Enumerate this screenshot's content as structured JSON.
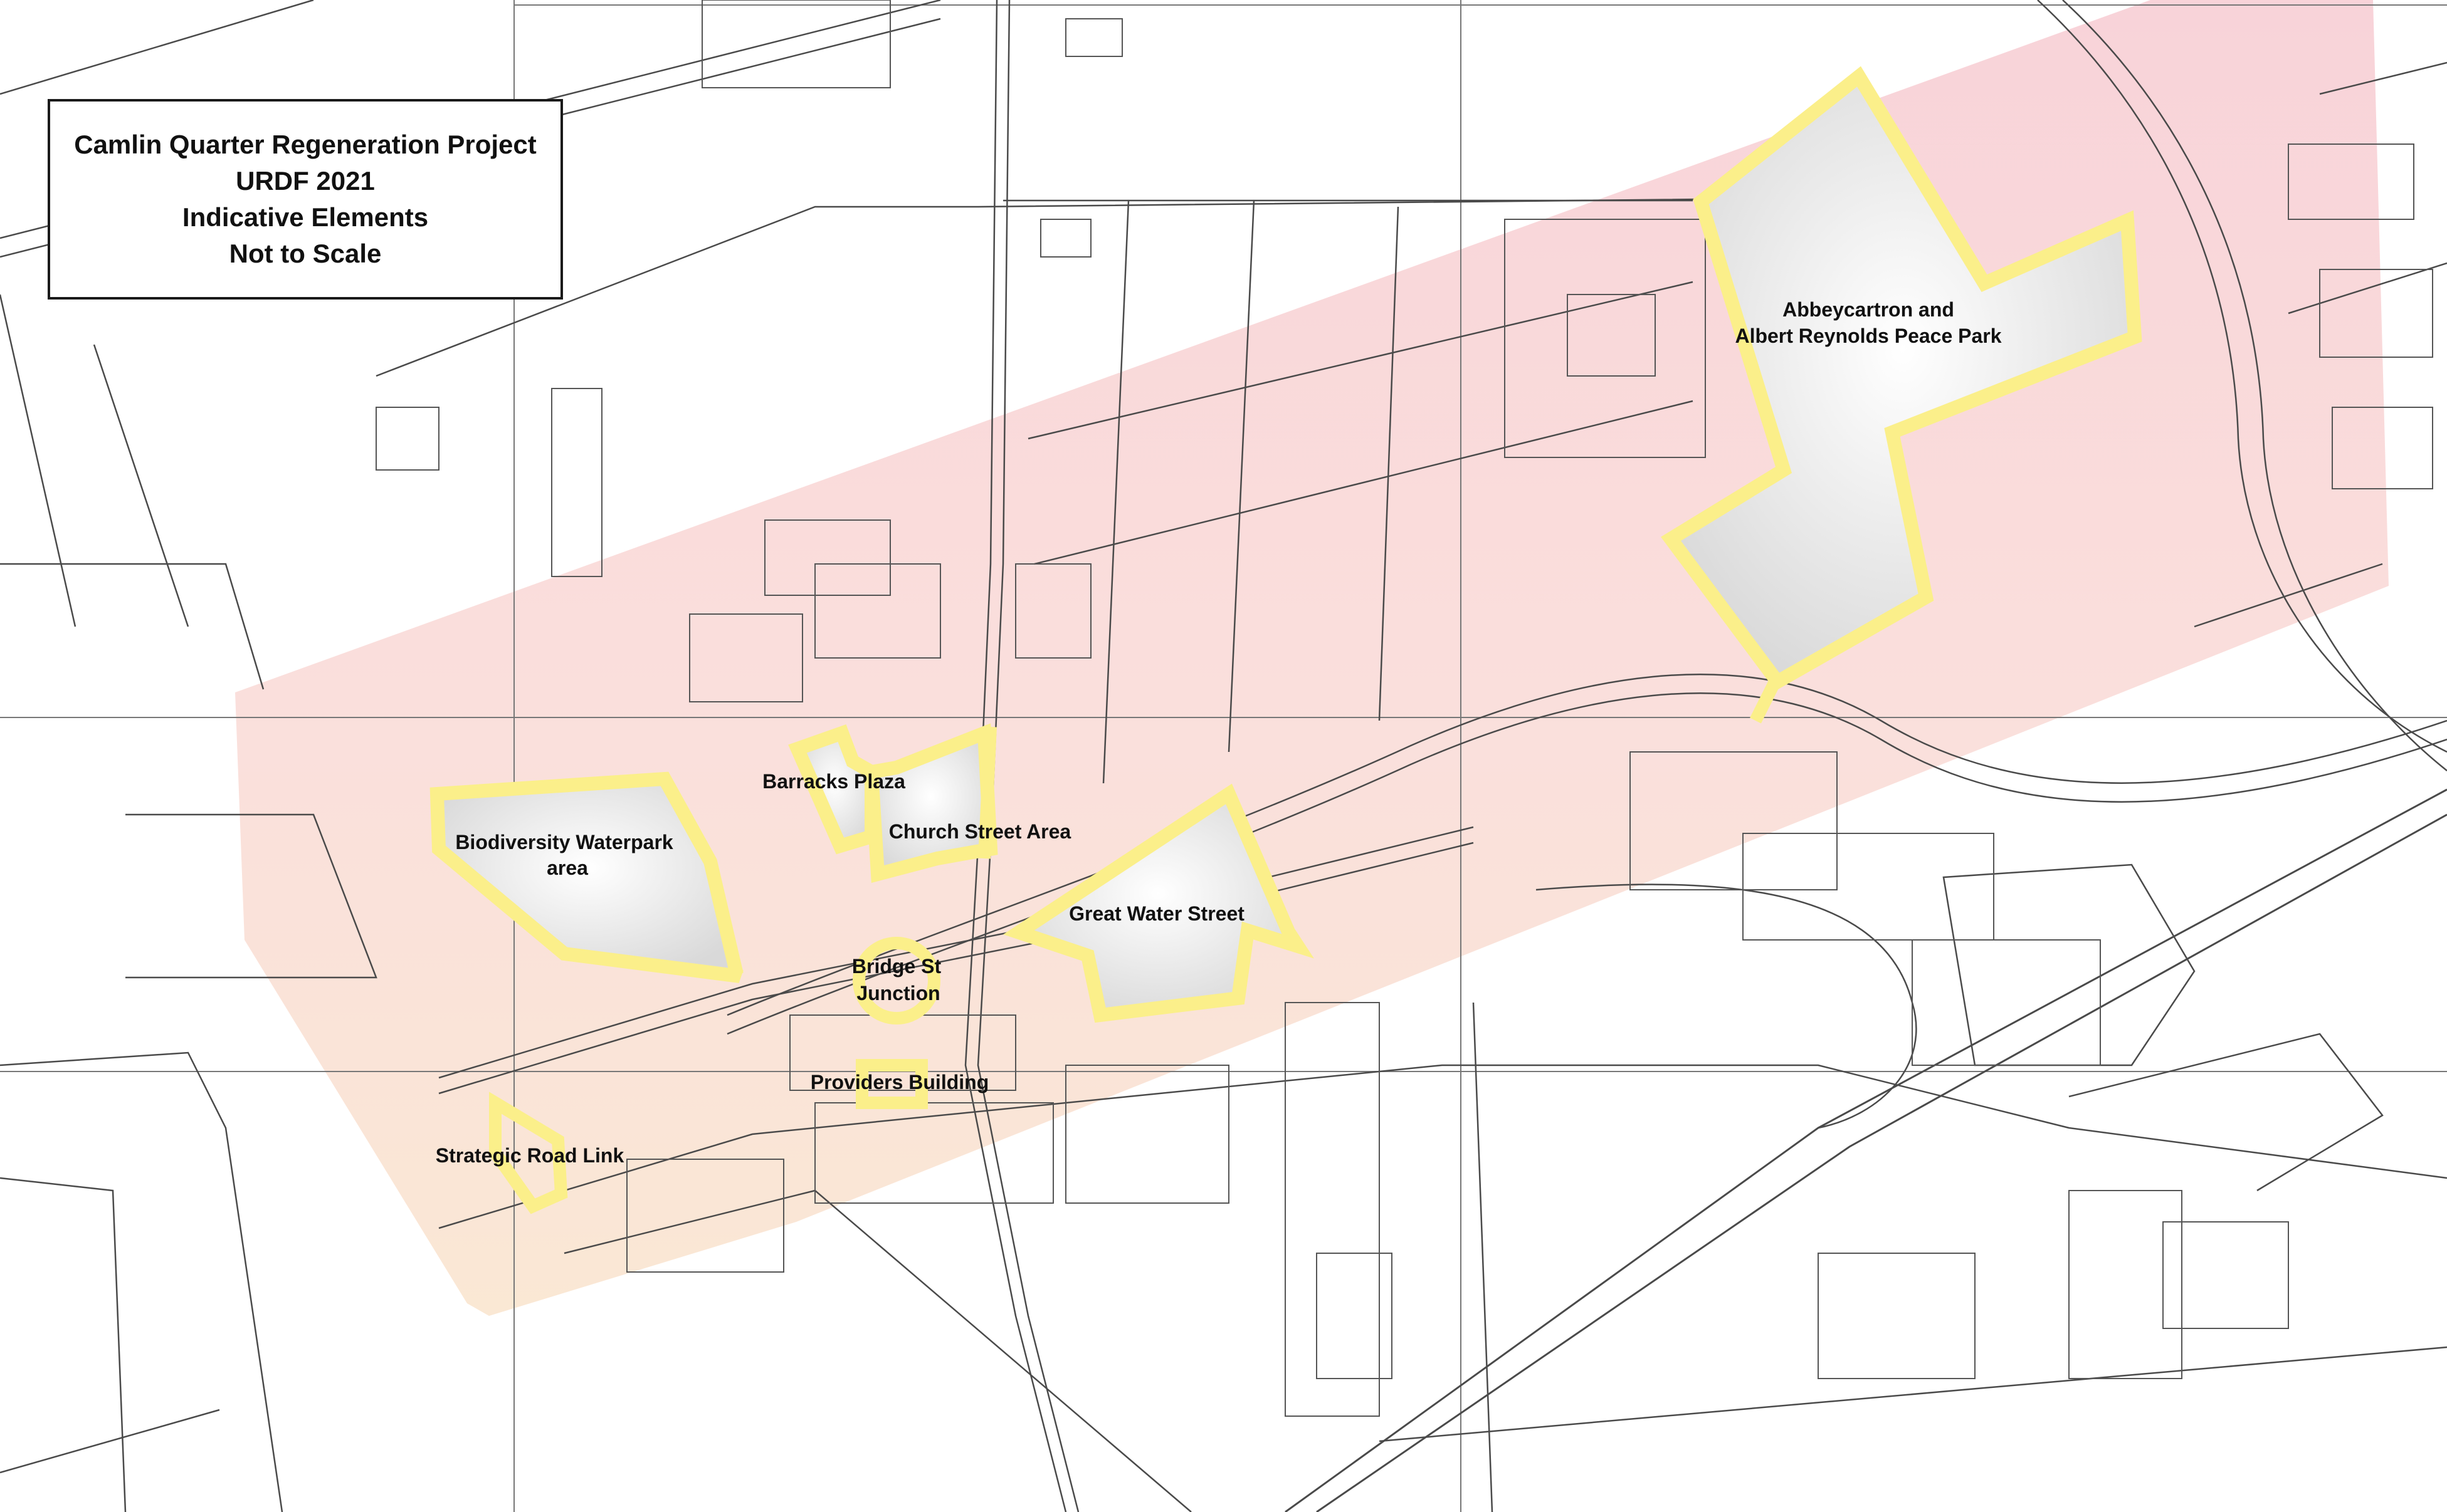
{
  "title_box": {
    "line1": "Camlin Quarter Regeneration Project",
    "line2": "URDF 2021",
    "line3": "Indicative Elements",
    "line4": "Not to Scale"
  },
  "labels": {
    "abbeycartron_1": "Abbeycartron and",
    "abbeycartron_2": "Albert Reynolds Peace Park",
    "barracks": "Barracks Plaza",
    "church_street": "Church Street Area",
    "biodiversity_1": "Biodiversity Waterpark",
    "biodiversity_2": "area",
    "great_water": "Great Water Street",
    "bridge_1": "Bridge St",
    "bridge_2": "Junction",
    "providers": "Providers Building",
    "strategic": "Strategic Road Link"
  },
  "colors": {
    "zone_fill": "#f7c9cf",
    "zone_fill_low": "#f9dcc8",
    "highlight_outline": "#fbef8a",
    "area_fill": "#e3e3e3",
    "linework": "#555555"
  }
}
